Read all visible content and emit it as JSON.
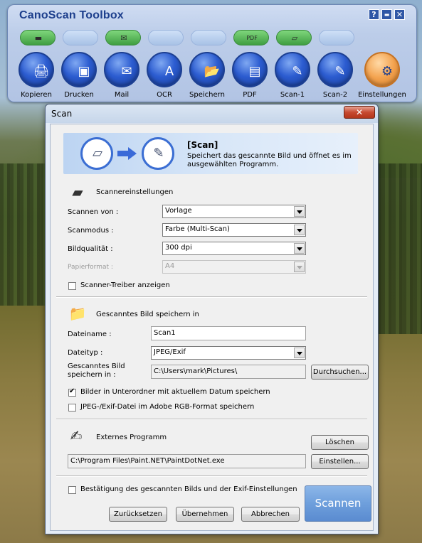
{
  "toolbox": {
    "title": "CanoScan Toolbox",
    "help_glyph": "?",
    "minimize_glyph": "▬",
    "close_glyph": "✕",
    "tools": [
      {
        "label": "Kopieren",
        "icon": "printer-icon",
        "glyph": "🖨",
        "pill": "on",
        "pill_glyph": "▬"
      },
      {
        "label": "Drucken",
        "icon": "photos-icon",
        "glyph": "▣",
        "pill": "off",
        "pill_glyph": ""
      },
      {
        "label": "Mail",
        "icon": "mail-icon",
        "glyph": "✉",
        "pill": "on",
        "pill_glyph": "✉"
      },
      {
        "label": "OCR",
        "icon": "ocr-icon",
        "glyph": "A",
        "pill": "off",
        "pill_glyph": ""
      },
      {
        "label": "Speichern",
        "icon": "folder-save-icon",
        "glyph": "📂",
        "pill": "off",
        "pill_glyph": ""
      },
      {
        "label": "PDF",
        "icon": "pdf-document-icon",
        "glyph": "▤",
        "pill": "on",
        "pill_glyph": "PDF"
      },
      {
        "label": "Scan-1",
        "icon": "scan1-icon",
        "glyph": "✎",
        "pill": "on",
        "pill_glyph": "▱"
      },
      {
        "label": "Scan-2",
        "icon": "scan2-icon",
        "glyph": "✎",
        "pill": "off",
        "pill_glyph": ""
      },
      {
        "label": "Einstellungen",
        "icon": "settings-icon",
        "glyph": "⚙",
        "pill": "none",
        "pill_glyph": ""
      }
    ]
  },
  "dialog": {
    "title": "Scan",
    "close_glyph": "✕",
    "banner": {
      "title": "[Scan]",
      "description": "Speichert das gescannte Bild und öffnet es im ausgewählten Programm."
    },
    "scanner_settings": {
      "section_title": "Scannereinstellungen",
      "scan_from_label": "Scannen von :",
      "scan_from_value": "Vorlage",
      "scan_mode_label": "Scanmodus :",
      "scan_mode_value": "Farbe (Multi-Scan)",
      "image_quality_label": "Bildqualität :",
      "image_quality_value": "300 dpi",
      "paper_format_label": "Papierformat :",
      "paper_format_value": "A4",
      "show_driver_label": "Scanner-Treiber anzeigen",
      "show_driver_checked": false
    },
    "save_settings": {
      "section_title": "Gescanntes Bild speichern in",
      "filename_label": "Dateiname :",
      "filename_value": "Scan1",
      "filetype_label": "Dateityp :",
      "filetype_value": "JPEG/Exif",
      "save_in_label_1": "Gescanntes Bild",
      "save_in_label_2": "speichern in :",
      "save_in_value": "C:\\Users\\mark\\Pictures\\",
      "browse_label": "Durchsuchen...",
      "subfolder_label": "Bilder in Unterordner mit aktuellem Datum speichern",
      "subfolder_checked": true,
      "adobe_rgb_label": "JPEG-/Exif-Datei im Adobe RGB-Format speichern",
      "adobe_rgb_checked": false
    },
    "external_program": {
      "section_title": "Externes Programm",
      "delete_label": "Löschen",
      "path_value": "C:\\Program Files\\Paint.NET\\PaintDotNet.exe",
      "setup_label": "Einstellen..."
    },
    "confirm_label": "Bestätigung des gescannten Bilds und der Exif-Einstellungen",
    "confirm_checked": false,
    "reset_label": "Zurücksetzen",
    "apply_label": "Übernehmen",
    "cancel_label": "Abbrechen",
    "scan_label": "Scannen"
  },
  "colors": {
    "toolbox_title": "#1c3e8c",
    "tool_ball": "#2c5cd0",
    "settings_ball": "#f3a24e",
    "scan_button": "#6e9fdc",
    "close_button": "#c74a31"
  }
}
